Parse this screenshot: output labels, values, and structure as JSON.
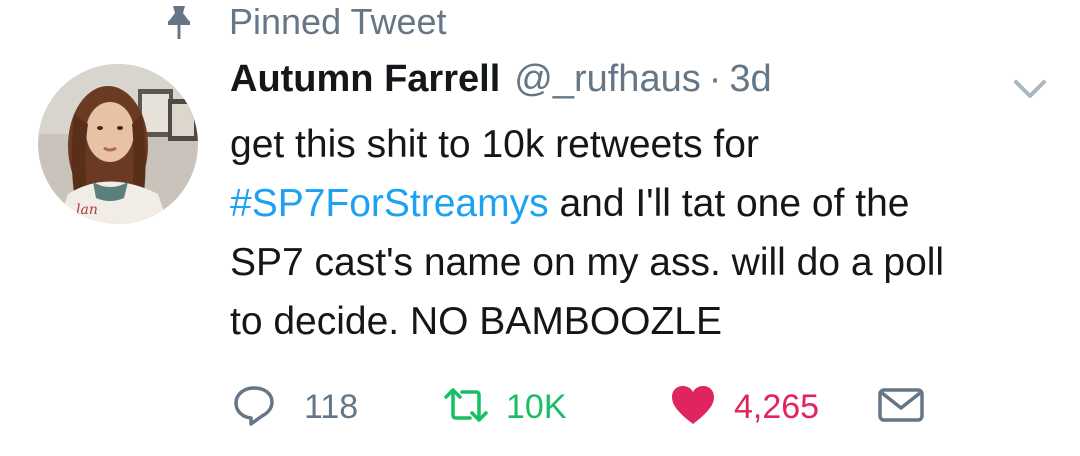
{
  "pinned": {
    "icon": "pin-icon",
    "label": "Pinned Tweet"
  },
  "tweet": {
    "author_name": "Autumn Farrell",
    "author_handle": "@_rufhaus",
    "separator": "·",
    "timestamp": "3d",
    "text": {
      "line1": "get this shit to 10k retweets for",
      "hashtag": "#SP7ForStreamys",
      "line2_rest": " and I'll tat one of the",
      "line3": "SP7 cast's name on my ass. will do a poll",
      "line4": "to decide. NO BAMBOOZLE"
    }
  },
  "actions": {
    "reply_count": "118",
    "retweet_count": "10K",
    "like_count": "4,265"
  },
  "colors": {
    "secondary_text": "#657786",
    "hashtag": "#1da1f2",
    "retweet": "#17bf63",
    "like": "#e0245e"
  }
}
